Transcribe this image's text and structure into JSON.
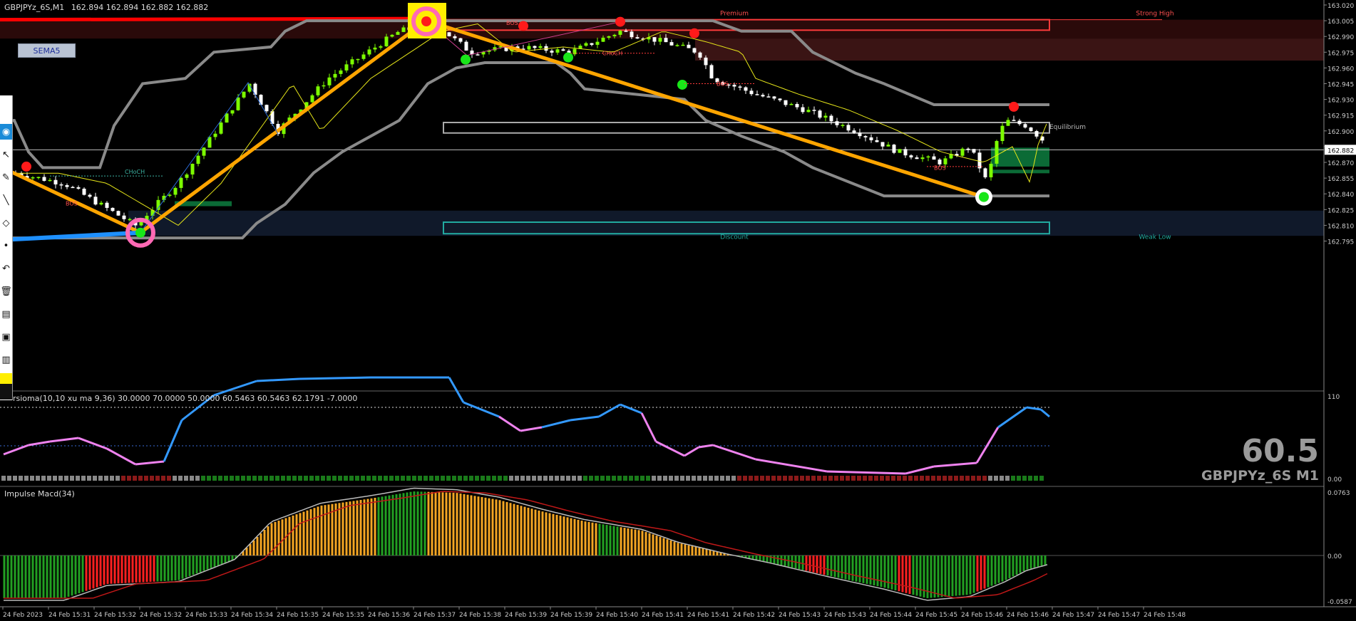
{
  "header": {
    "symbol_info": "GBPJPYz_6S,M1",
    "quotes": "162.894 162.894 162.882 162.882"
  },
  "sema_button": "SEMA5",
  "zone_labels": {
    "premium": "Premium",
    "strong_high": "Strong High",
    "equilibrium": "Equilibrium",
    "discount": "Discount",
    "weak_low": "Weak Low",
    "choch_1": "CHoCH",
    "choch_2": "CHoCH",
    "bos_1": "BOS",
    "bos_2": "BOS",
    "bos_3": "BOS",
    "bos_4": "BOS",
    "choch_3": "CHoCH"
  },
  "price_axis": {
    "ticks": [
      "163.020",
      "163.005",
      "162.990",
      "162.975",
      "162.960",
      "162.945",
      "162.930",
      "162.915",
      "162.900",
      "162.885",
      "162.870",
      "162.855",
      "162.840",
      "162.825",
      "162.810",
      "162.795"
    ],
    "current_price": "162.882"
  },
  "rsi_pane": {
    "label": "rsioma(10,10 xu ma 9,36) 30.0000 70.0000 50.0000 60.5463 60.5463 62.1791 -7.0000",
    "axis_top": "110",
    "axis_bottom": "0.00",
    "big_value": "60.5",
    "big_symbol": "GBPJPYz_6S M1"
  },
  "macd_pane": {
    "label": "Impulse Macd(34)",
    "axis_top": "0.0763",
    "axis_mid": "0.00",
    "axis_bottom": "-0.0587"
  },
  "time_axis": [
    "24 Feb 2023",
    "24 Feb 15:31",
    "24 Feb 15:32",
    "24 Feb 15:32",
    "24 Feb 15:33",
    "24 Feb 15:34",
    "24 Feb 15:35",
    "24 Feb 15:35",
    "24 Feb 15:36",
    "24 Feb 15:37",
    "24 Feb 15:38",
    "24 Feb 15:39",
    "24 Feb 15:39",
    "24 Feb 15:40",
    "24 Feb 15:41",
    "24 Feb 15:41",
    "24 Feb 15:42",
    "24 Feb 15:43",
    "24 Feb 15:43",
    "24 Feb 15:44",
    "24 Feb 15:45",
    "24 Feb 15:46",
    "24 Feb 15:46",
    "24 Feb 15:47",
    "24 Feb 15:47",
    "24 Feb 15:48"
  ],
  "colors": {
    "bull_candle": "#7cfc00",
    "bear_candle": "#ffffff",
    "ema_line": "#e6e619",
    "band": "#8a8a8a",
    "zigzag": "#ffa500",
    "rsi_up": "#3399ff",
    "rsi_down": "#ee82ee",
    "macd_green": "#22a022",
    "macd_red": "#ff2020",
    "macd_orange": "#f5a623"
  }
}
